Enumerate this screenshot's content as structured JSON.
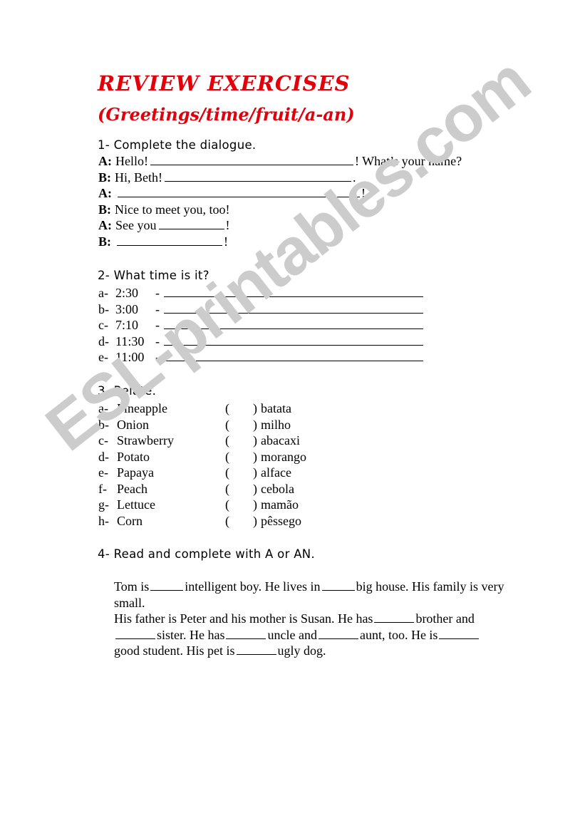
{
  "worksheet": {
    "title_main": "REVIEW EXERCISES",
    "title_sub": "(Greetings/time/fruit/a-an)",
    "title_color": "#e3000b",
    "watermark_text": "ESL-printables.com",
    "watermark_color": "#cccccc"
  },
  "exercise1": {
    "heading": "1- Complete the dialogue.",
    "lines": [
      {
        "speaker": "A:",
        "before": "Hello!",
        "blank_width": 285,
        "after": "! What’s your name?"
      },
      {
        "speaker": "B:",
        "before": "Hi, Beth!",
        "blank_width": 262,
        "after": "."
      },
      {
        "speaker": "A:",
        "before": "",
        "blank_width": 340,
        "after": "!"
      },
      {
        "speaker": "B:",
        "before": "Nice to meet you, too!",
        "blank_width": 0,
        "after": ""
      },
      {
        "speaker": "A:",
        "before": "See you",
        "blank_width": 92,
        "after": "!"
      },
      {
        "speaker": "B:",
        "before": "",
        "blank_width": 148,
        "after": "!"
      }
    ]
  },
  "exercise2": {
    "heading": "2- What time is it?",
    "items": [
      {
        "letter": "a-",
        "time": "2:30",
        "dash": "-"
      },
      {
        "letter": "b-",
        "time": "3:00",
        "dash": "-"
      },
      {
        "letter": "c-",
        "time": "7:10",
        "dash": "-"
      },
      {
        "letter": "d-",
        "time": "11:30",
        "dash": "-"
      },
      {
        "letter": "e-",
        "time": "11:00",
        "dash": "-"
      }
    ]
  },
  "exercise3": {
    "heading": "3- Relate.",
    "paren_open": "(",
    "paren_close": ")",
    "items": [
      {
        "letter": "a-",
        "english": "Pineapple",
        "portuguese": "batata"
      },
      {
        "letter": "b-",
        "english": "Onion",
        "portuguese": "milho"
      },
      {
        "letter": "c-",
        "english": "Strawberry",
        "portuguese": "abacaxi"
      },
      {
        "letter": "d-",
        "english": "Potato",
        "portuguese": "morango"
      },
      {
        "letter": "e-",
        "english": "Papaya",
        "portuguese": "alface"
      },
      {
        "letter": "f-",
        "english": "Peach",
        "portuguese": "cebola"
      },
      {
        "letter": "g-",
        "english": "Lettuce",
        "portuguese": "mamão"
      },
      {
        "letter": "h-",
        "english": "Corn",
        "portuguese": "pêssego"
      }
    ]
  },
  "exercise4": {
    "heading": "4- Read and complete with A or AN.",
    "paragraph1": {
      "s1": "Tom is",
      "s2": "intelligent boy. He lives in",
      "s3": "big house. His family is very small."
    },
    "paragraph2": {
      "s1": "His father is Peter and his mother is Susan. He has",
      "s2": "brother and",
      "s3": "sister. He has",
      "s4": "uncle and",
      "s5": "aunt, too. He is",
      "s6": "good student. His pet is",
      "s7": "ugly dog."
    }
  }
}
